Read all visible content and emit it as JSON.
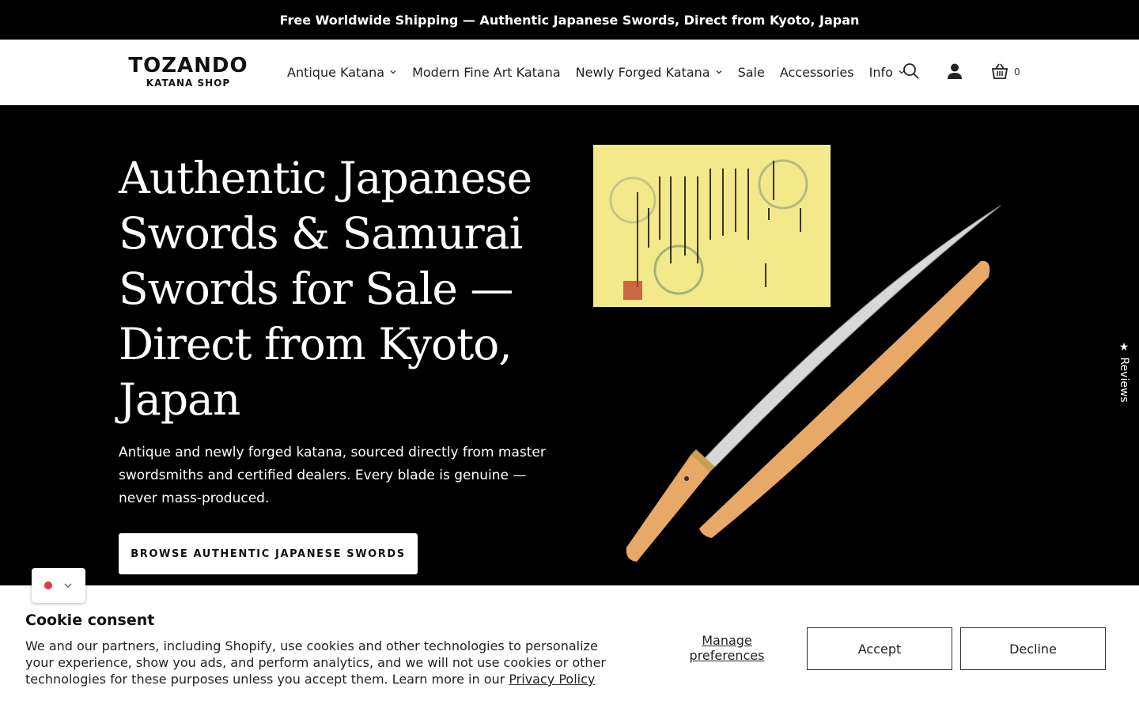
{
  "announcement": "Free Worldwide Shipping — Authentic Japanese Swords, Direct from Kyoto, Japan",
  "logo": {
    "line1": "TOZANDO",
    "line2": "KATANA SHOP"
  },
  "nav": {
    "items": [
      {
        "label": "Antique Katana",
        "dropdown": true
      },
      {
        "label": "Modern Fine Art Katana",
        "dropdown": false
      },
      {
        "label": "Newly Forged Katana",
        "dropdown": true
      },
      {
        "label": "Sale",
        "dropdown": false
      },
      {
        "label": "Accessories",
        "dropdown": false
      },
      {
        "label": "Info",
        "dropdown": true
      }
    ],
    "icons": [
      "search-icon",
      "account-icon",
      "cart-icon"
    ],
    "cart_count": "0"
  },
  "hero": {
    "title": "Authentic Japanese Swords & Samurai Swords for Sale — Direct from Kyoto, Japan",
    "subtitle": "Antique and newly forged katana, sourced directly from master swordsmiths and certified dealers. Every blade is genuine — never mass-produced.",
    "button": "BROWSE AUTHENTIC JAPANESE SWORDS"
  },
  "reviews_tab": "★ Reviews",
  "cookie": {
    "title": "Cookie consent",
    "text": "We and our partners, including Shopify, use cookies and other technologies to personalize your experience, show you ads, and perform analytics, and we will not use cookies or other technologies for these purposes unless you accept them. Learn more in our ",
    "link": "Privacy Policy",
    "manage": "Manage preferences",
    "accept": "Accept",
    "decline": "Decline"
  },
  "colors": {
    "announce_bg": "#000000",
    "hero_bg": "#000000",
    "certificate": "#f3e98a",
    "scabbard": "#e8a868",
    "flag_dot": "#e23b4a"
  }
}
